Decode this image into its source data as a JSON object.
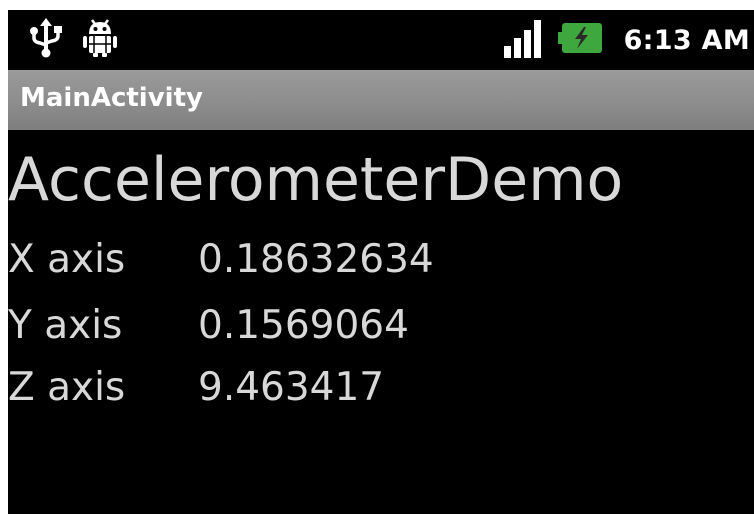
{
  "status_bar": {
    "time": "6:13 AM",
    "icons": [
      "usb-icon",
      "android-debug-icon",
      "signal-strength-icon",
      "battery-charging-icon"
    ],
    "battery_color": "#3ea83e"
  },
  "title_bar": {
    "title": "MainActivity"
  },
  "content": {
    "heading": "AccelerometerDemo",
    "axes": [
      {
        "label": "X axis",
        "value": "0.18632634"
      },
      {
        "label": "Y axis",
        "value": "0.1569064"
      },
      {
        "label": "Z axis",
        "value": "9.463417"
      }
    ]
  }
}
